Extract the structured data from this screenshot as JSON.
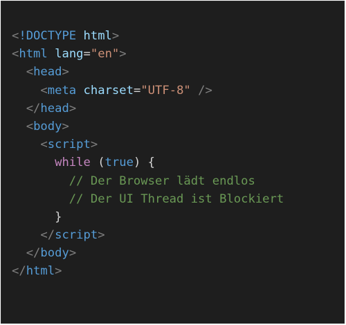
{
  "code": {
    "doctype": "!DOCTYPE",
    "doctype_value": "html",
    "html_tag": "html",
    "html_attr": "lang",
    "html_attr_value": "\"en\"",
    "head_tag": "head",
    "meta_tag": "meta",
    "meta_attr": "charset",
    "meta_attr_value": "\"UTF-8\"",
    "body_tag": "body",
    "script_tag": "script",
    "while_keyword": "while",
    "true_keyword": "true",
    "comment_1": "// Der Browser lädt endlos",
    "comment_2": "// Der UI Thread ist Blockiert",
    "close_brace": "}"
  },
  "colors": {
    "background": "#1e1e1e",
    "tag": "#569cd6",
    "attribute": "#9cdcfe",
    "string": "#ce9178",
    "keyword": "#c586c0",
    "comment": "#6a9955",
    "punctuation": "#808080",
    "text": "#d4d4d4"
  }
}
